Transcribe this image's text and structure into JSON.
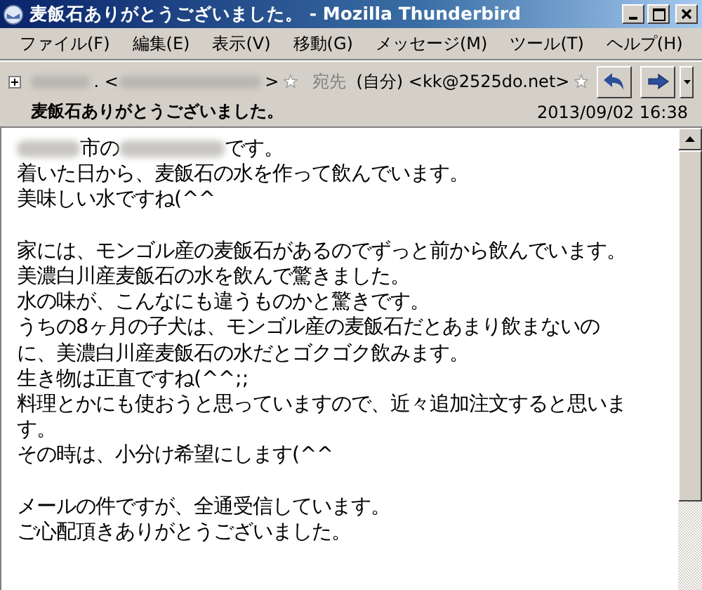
{
  "window": {
    "title": "麦飯石ありがとうございました。 - Mozilla Thunderbird"
  },
  "menu": [
    "ファイル(F)",
    "編集(E)",
    "表示(V)",
    "移動(G)",
    "メッセージ(M)",
    "ツール(T)",
    "ヘルプ(H)"
  ],
  "header": {
    "expanded": false,
    "from": [
      {
        "kind": "redacted"
      },
      {
        "kind": "text",
        "text": ". <"
      },
      {
        "kind": "redacted"
      },
      {
        "kind": "text",
        "text": ">"
      },
      {
        "kind": "star"
      }
    ],
    "to_label": "宛先",
    "to": [
      {
        "kind": "text",
        "text": "(自分) <kk@2525do.net>"
      },
      {
        "kind": "star"
      }
    ],
    "subject": "麦飯石ありがとうございました。",
    "date": "2013/09/02 16:38"
  },
  "body": {
    "paragraphs": [
      [
        [
          {
            "kind": "redacted"
          },
          {
            "kind": "text",
            "text": "市の"
          },
          {
            "kind": "redacted"
          },
          {
            "kind": "text",
            "text": "です。"
          }
        ],
        "着いた日から、麦飯石の水を作って飲んでいます。",
        "美味しい水ですね(^^"
      ],
      [
        "家には、モンゴル産の麦飯石があるのでずっと前から飲んでいます。",
        "美濃白川産麦飯石の水を飲んで驚きました。",
        "水の味が、こんなにも違うものかと驚きです。",
        "うちの8ヶ月の子犬は、モンゴル産の麦飯石だとあまり飲まないの",
        "に、美濃白川産麦飯石の水だとゴクゴク飲みます。",
        "生き物は正直ですね(^^;;",
        "料理とかにも使おうと思っていますので、近々追加注文すると思いま",
        "す。",
        "その時は、小分け希望にします(^^"
      ],
      [
        "メールの件ですが、全通受信しています。",
        "ご心配頂きありがとうございました。"
      ]
    ]
  }
}
